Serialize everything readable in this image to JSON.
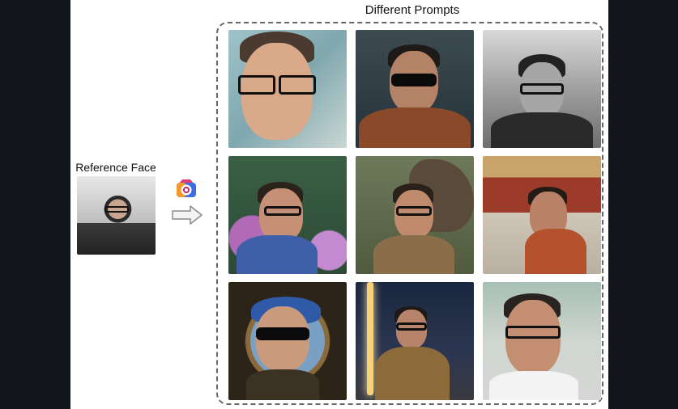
{
  "title": "Different Prompts",
  "reference": {
    "label": "Reference Face"
  },
  "icons": [
    "camera-icon",
    "right-arrow-icon"
  ],
  "colors": {
    "background": "#111418",
    "canvas": "#ffffff",
    "dashed_border": "#666666"
  },
  "tiles_count": 9
}
